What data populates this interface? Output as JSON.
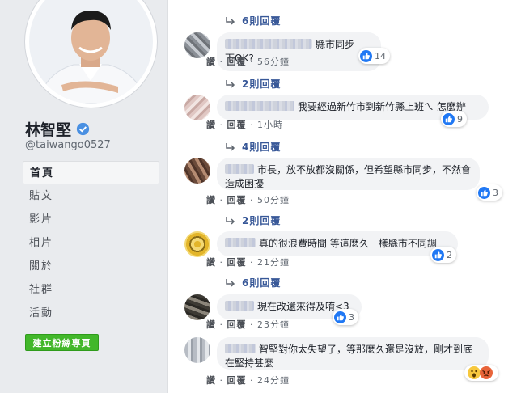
{
  "profile": {
    "name": "林智堅",
    "handle": "@taiwango0527"
  },
  "nav": [
    "首頁",
    "貼文",
    "影片",
    "相片",
    "關於",
    "社群",
    "活動"
  ],
  "create_button": "建立粉絲專頁",
  "reply_links": [
    "6則回覆",
    "2則回覆",
    "4則回覆",
    "2則回覆",
    "6則回覆"
  ],
  "action_like": "讚",
  "action_reply": "回覆",
  "comments": [
    {
      "text": "縣市同步一下OK?",
      "time": "56分鐘",
      "reactions": "14"
    },
    {
      "text": "我要經過新竹市到新竹縣上班ㄟ 怎麼辦",
      "time": "1小時",
      "reactions": "9"
    },
    {
      "text": "市長，放不放都沒關係，但希望縣市同步，不然會造成困擾",
      "time": "50分鐘",
      "reactions": "3"
    },
    {
      "text": "真的很浪費時間 等這麼久一樣縣市不同調",
      "time": "21分鐘",
      "reactions": "2"
    },
    {
      "text": "現在改還來得及唷<3",
      "time": "23分鐘",
      "reactions": "3"
    },
    {
      "text": "智堅對你太失望了，等那麼久還是沒放，剛才到底在堅持甚麼",
      "time": "24分鐘",
      "reactions": ""
    }
  ],
  "colors": {
    "fb_blue": "#385898",
    "like_blue": "#2078f4",
    "green": "#42b72a",
    "sidebar_bg": "#e9ebee"
  }
}
